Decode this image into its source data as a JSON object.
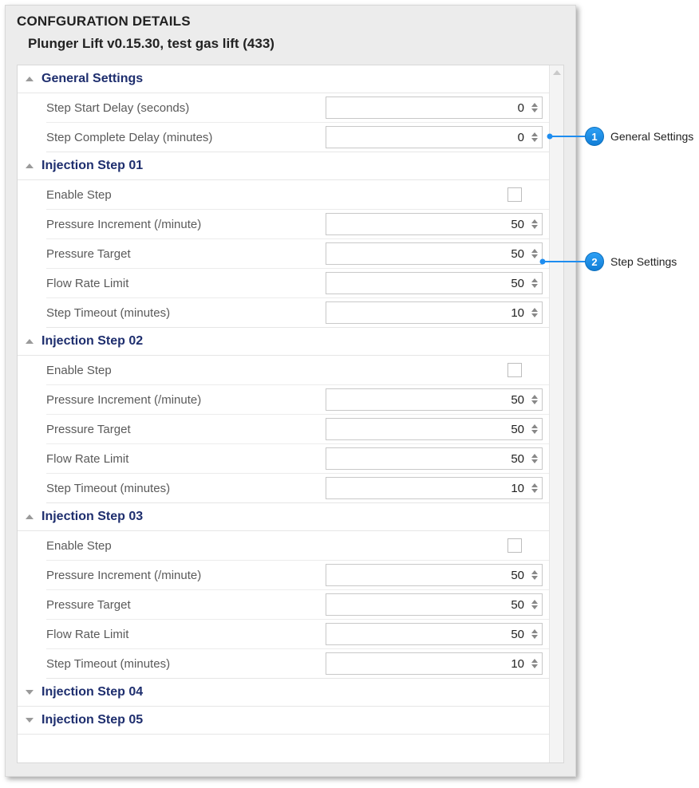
{
  "panel": {
    "title": "CONFGURATION DETAILS",
    "subtitle": "Plunger Lift v0.15.30, test gas lift (433)"
  },
  "sections": {
    "general": {
      "title": "General Settings",
      "rows": {
        "start_delay": {
          "label": "Step Start Delay (seconds)",
          "value": "0"
        },
        "complete_delay": {
          "label": "Step Complete Delay (minutes)",
          "value": "0"
        }
      }
    },
    "step01": {
      "title": "Injection Step 01",
      "enable_label": "Enable Step",
      "rows": {
        "pressure_inc": {
          "label": "Pressure Increment (/minute)",
          "value": "50"
        },
        "pressure_target": {
          "label": "Pressure Target",
          "value": "50"
        },
        "flow_limit": {
          "label": "Flow Rate Limit",
          "value": "50"
        },
        "timeout": {
          "label": "Step Timeout (minutes)",
          "value": "10"
        }
      }
    },
    "step02": {
      "title": "Injection Step 02",
      "enable_label": "Enable Step",
      "rows": {
        "pressure_inc": {
          "label": "Pressure Increment (/minute)",
          "value": "50"
        },
        "pressure_target": {
          "label": "Pressure Target",
          "value": "50"
        },
        "flow_limit": {
          "label": "Flow Rate Limit",
          "value": "50"
        },
        "timeout": {
          "label": "Step Timeout (minutes)",
          "value": "10"
        }
      }
    },
    "step03": {
      "title": "Injection Step 03",
      "enable_label": "Enable Step",
      "rows": {
        "pressure_inc": {
          "label": "Pressure Increment (/minute)",
          "value": "50"
        },
        "pressure_target": {
          "label": "Pressure Target",
          "value": "50"
        },
        "flow_limit": {
          "label": "Flow Rate Limit",
          "value": "50"
        },
        "timeout": {
          "label": "Step Timeout (minutes)",
          "value": "10"
        }
      }
    },
    "step04": {
      "title": "Injection Step 04"
    },
    "step05": {
      "title": "Injection Step 05"
    }
  },
  "callouts": {
    "c1": {
      "num": "1",
      "text": "General Settings"
    },
    "c2": {
      "num": "2",
      "text": "Step Settings"
    }
  }
}
